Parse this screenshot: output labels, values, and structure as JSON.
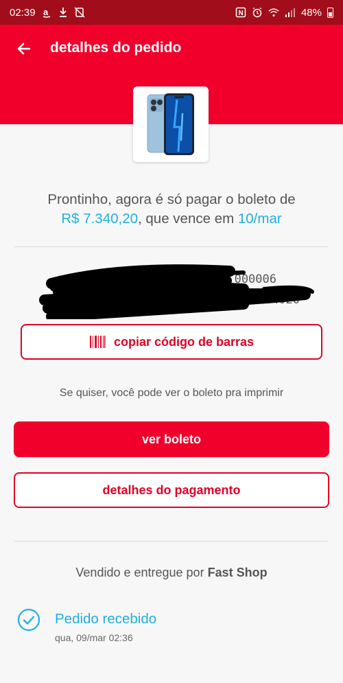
{
  "status_bar": {
    "time": "02:39",
    "battery": "48%",
    "icons_left": [
      "amazon-icon",
      "download-icon",
      "do-not-disturb-off-icon"
    ],
    "icons_right": [
      "nfc-icon",
      "alarm-icon",
      "wifi-icon",
      "signal-icon",
      "battery-icon"
    ]
  },
  "header": {
    "title": "detalhes do pedido",
    "back_icon": "arrow-left-icon",
    "color": "#f0002b"
  },
  "product": {
    "image": "iphone-13-pro-image"
  },
  "message": {
    "prefix": "Prontinho, agora é só pagar o boleto de",
    "amount": "R$ 7.340,20",
    "middle": ", que vence em ",
    "due_date": "10/mar"
  },
  "barcode": {
    "line1": "000006",
    "line2": "00000784020",
    "redacted": true
  },
  "buttons": {
    "copy_barcode": "copiar código de barras",
    "view_boleto": "ver boleto",
    "payment_details": "detalhes do pagamento"
  },
  "hint_text": "Se quiser, você pode ver o boleto pra imprimir",
  "seller": {
    "prefix": "Vendido e entregue por",
    "name": "Fast Shop"
  },
  "timeline": {
    "status": "Pedido recebido",
    "date": "qua, 09/mar 02:36"
  },
  "colors": {
    "brand_red": "#f0002b",
    "status_bar": "#a10d1a",
    "accent_blue": "#1fb0e0"
  }
}
